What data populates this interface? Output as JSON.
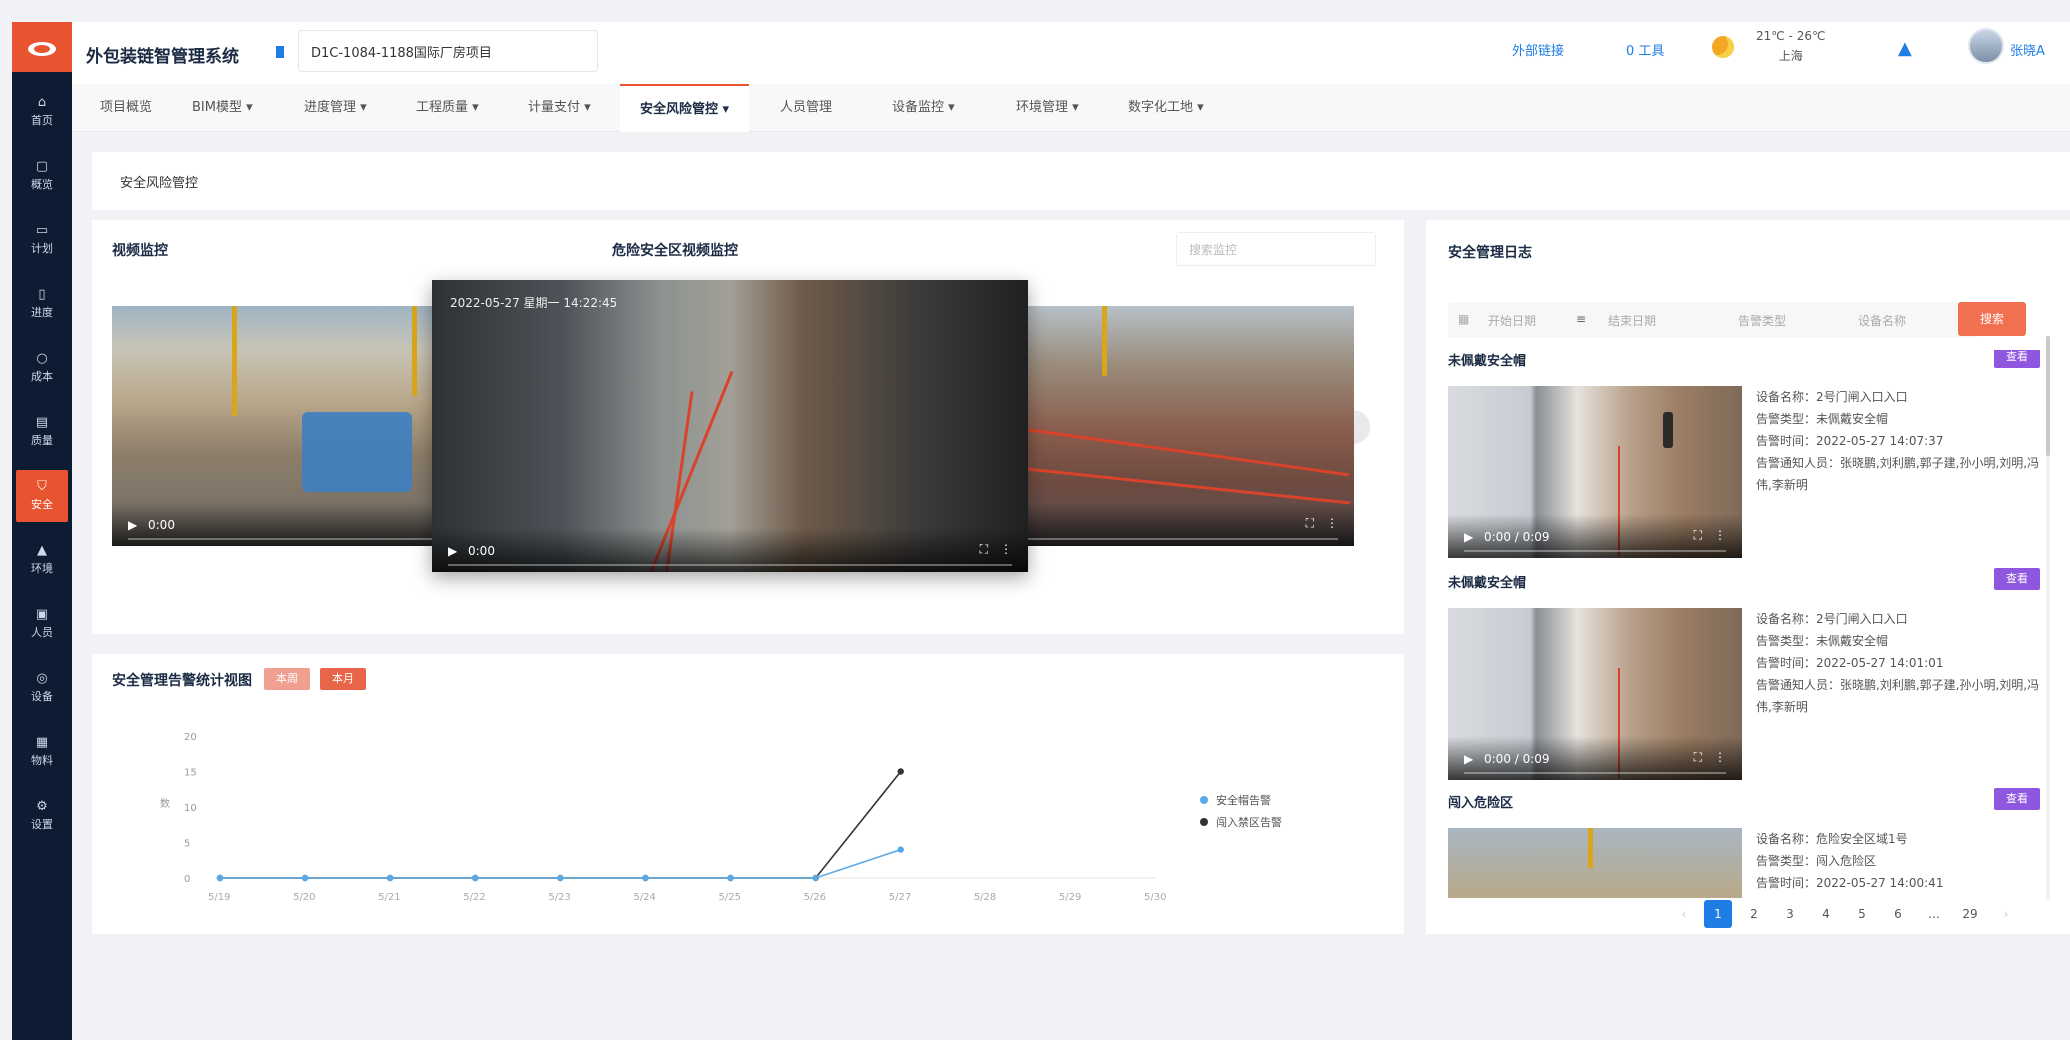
{
  "app": {
    "title": "外包装链智管理系统"
  },
  "header": {
    "project": "D1C-1084-1188国际厂房项目",
    "links": [
      "外部链接",
      "0 工具"
    ],
    "weather": {
      "temp": "21℃ - 26℃",
      "condition": "上海"
    },
    "user": "张晓A"
  },
  "sidebar": {
    "items": [
      {
        "icon": "home-icon",
        "label": "首页"
      },
      {
        "icon": "doc-icon",
        "label": "概览"
      },
      {
        "icon": "doc-icon",
        "label": "计划"
      },
      {
        "icon": "doc-icon",
        "label": "进度"
      },
      {
        "icon": "circle-icon",
        "label": "成本"
      },
      {
        "icon": "doc-icon",
        "label": "质量"
      },
      {
        "icon": "shield-icon",
        "label": "安全"
      },
      {
        "icon": "doc-icon",
        "label": "环境"
      },
      {
        "icon": "doc-icon",
        "label": "人员"
      },
      {
        "icon": "doc-icon",
        "label": "设备"
      },
      {
        "icon": "doc-icon",
        "label": "物料"
      },
      {
        "icon": "gear-icon",
        "label": "设置"
      }
    ]
  },
  "menu": {
    "items": [
      "项目概览",
      "BIM模型 ▾",
      "进度管理 ▾",
      "工程质量 ▾",
      "计量支付 ▾",
      "安全风险管控 ▾",
      "人员管理",
      "设备监控 ▾",
      "环境管理 ▾",
      "数字化工地 ▾"
    ]
  },
  "breadcrumb": "安全风险管控",
  "video_panel": {
    "title": "视频监控",
    "subtitle": "危险安全区视频监控",
    "search_placeholder": "搜索监控",
    "timestamp": "2022-05-27 星期一 14:22:45",
    "time_main": "0:00",
    "time_side": "0:00"
  },
  "chart_panel": {
    "title": "安全管理告警统计视图",
    "tags": [
      "本周",
      "本月"
    ]
  },
  "chart_data": {
    "type": "line",
    "categories": [
      "5/19",
      "5/20",
      "5/21",
      "5/22",
      "5/23",
      "5/24",
      "5/25",
      "5/26",
      "5/27",
      "5/28",
      "5/29",
      "5/30"
    ],
    "ylabel": "数",
    "ylim": [
      0,
      20
    ],
    "yticks": [
      0,
      5,
      10,
      15,
      20
    ],
    "series": [
      {
        "name": "安全帽告警",
        "color": "#5aa9e6",
        "values": [
          0,
          0,
          0,
          0,
          0,
          0,
          0,
          0,
          4,
          null,
          null,
          null
        ]
      },
      {
        "name": "闯入禁区告警",
        "color": "#333333",
        "values": [
          0,
          0,
          0,
          0,
          0,
          0,
          0,
          0,
          15,
          null,
          null,
          null
        ]
      }
    ],
    "legend": "right"
  },
  "log_panel": {
    "title": "安全管理日志",
    "filters": [
      "开始日期",
      "结束日期",
      "告警类型",
      "设备名称"
    ],
    "search_label": "搜索",
    "items": [
      {
        "type": "未佩戴安全帽",
        "action": "查看",
        "device": "设备名称：2号门闸入口入口",
        "event": "告警类型：未佩戴安全帽",
        "time": "告警时间：2022-05-27 14:07:37",
        "notify": "告警通知人员：张晓鹏,刘利鹏,郭子建,孙小明,刘明,冯伟,李新明",
        "video_time": "0:00 / 0:09"
      },
      {
        "type": "未佩戴安全帽",
        "action": "查看",
        "device": "设备名称：2号门闸入口入口",
        "event": "告警类型：未佩戴安全帽",
        "time": "告警时间：2022-05-27 14:01:01",
        "notify": "告警通知人员：张晓鹏,刘利鹏,郭子建,孙小明,刘明,冯伟,李新明",
        "video_time": "0:00 / 0:09"
      },
      {
        "type": "闯入危险区",
        "action": "查看",
        "device": "设备名称：危险安全区域1号",
        "event": "告警类型：闯入危险区",
        "time": "告警时间：2022-05-27 14:00:41",
        "notify": "",
        "video_time": ""
      }
    ],
    "pages": [
      "1",
      "2",
      "3",
      "4",
      "5",
      "6",
      "…",
      "29"
    ]
  }
}
